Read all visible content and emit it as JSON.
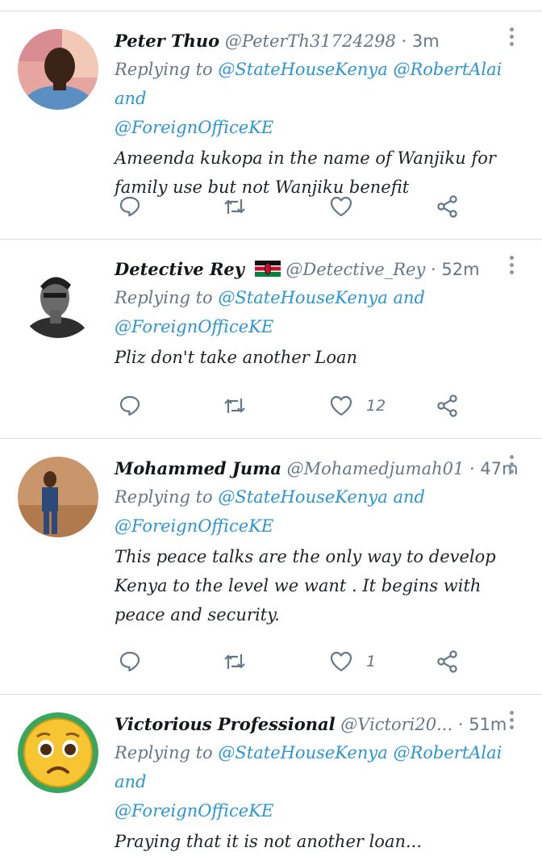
{
  "tweets": [
    {
      "name": "Peter Thuo",
      "handle": "@PeterTh31724298",
      "time": "3m",
      "replying_prefix": "Replying to",
      "reply_line1": [
        "@StateHouseKenya",
        "@RobertAlai",
        "and"
      ],
      "reply_line2": "@ForeignOfficeKE",
      "text": "Ameenda kukopa in the name of Wanjiku for family use but not Wanjiku benefit",
      "likes": ""
    },
    {
      "name": "Detective Rey",
      "handle": "@Detective_Rey",
      "time": "52m",
      "replying_prefix": "Replying to",
      "reply_line1": [
        "@StateHouseKenya",
        "and"
      ],
      "reply_line2": "@ForeignOfficeKE",
      "text": "Pliz don't take another Loan",
      "likes": "12"
    },
    {
      "name": "Mohammed Juma",
      "handle": "@Mohamedjumah01",
      "time": "47m",
      "replying_prefix": "Replying to",
      "reply_line1": [
        "@StateHouseKenya",
        "and"
      ],
      "reply_line2": "@ForeignOfficeKE",
      "text": "This peace talks are the only way to develop Kenya to the level we want . It begins with peace and security.",
      "likes": "1"
    },
    {
      "name": "Victorious Professional",
      "handle": "@Victori20...",
      "time": "51m",
      "replying_prefix": "Replying to",
      "reply_line1": [
        "@StateHouseKenya",
        "@RobertAlai",
        "and"
      ],
      "reply_line2": "@ForeignOfficeKE",
      "text": "Praying that it is not another loan...",
      "likes": ""
    }
  ],
  "icons": {
    "reply": "reply-icon",
    "retweet": "retweet-icon",
    "like": "heart-icon",
    "share": "share-icon",
    "more": "more-vertical-icon"
  },
  "colors": {
    "mention": "#2b95d3",
    "secondary": "#657786",
    "icon": "#657786",
    "divider": "#d6dde2"
  }
}
